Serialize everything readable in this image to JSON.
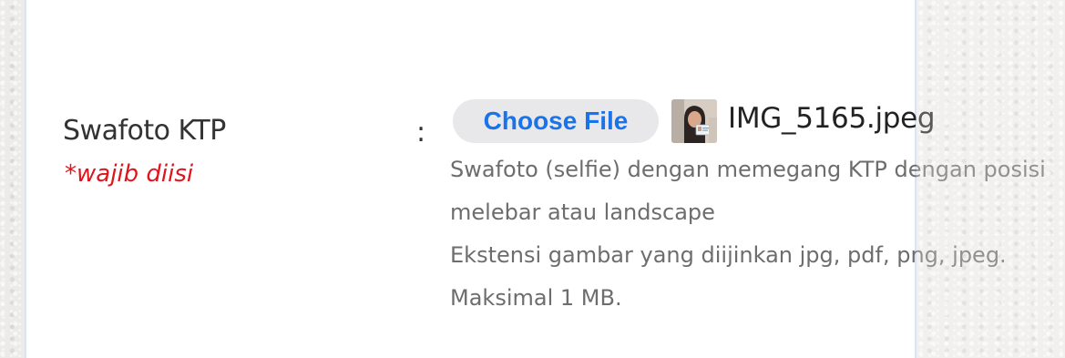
{
  "field": {
    "label": "Swafoto KTP",
    "required_note": "*wajib diisi",
    "separator": ":"
  },
  "file_input": {
    "button_label": "Choose File",
    "file_name": "IMG_5165.jpeg",
    "thumbnail_icon": "selfie-with-id-card-thumbnail"
  },
  "help": {
    "line1": "Swafoto (selfie) dengan memegang KTP dengan posisi",
    "line2": "melebar atau landscape",
    "line3": "Ekstensi gambar yang diijinkan jpg, pdf, png, jpeg.",
    "line4": "Maksimal 1 MB."
  },
  "colors": {
    "required": "#e0141b",
    "button_text": "#1a73e8",
    "button_bg": "#e8e8ea",
    "help_text": "#6d6d6d"
  }
}
